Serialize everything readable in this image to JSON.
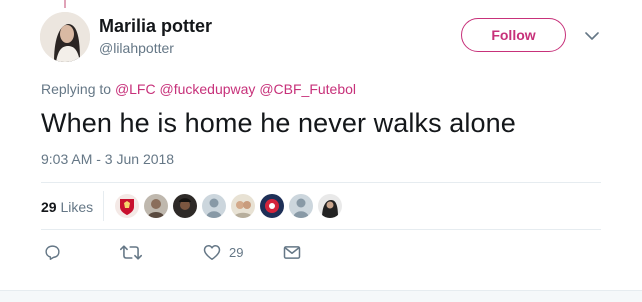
{
  "tweet": {
    "author": {
      "display_name": "Marilia potter",
      "handle": "@lilahpotter",
      "avatar_icon": "profile-photo"
    },
    "follow_label": "Follow",
    "replying_prefix": "Replying to",
    "replying_to": [
      "@LFC",
      "@fuckedupway",
      "@CBF_Futebol"
    ],
    "text": "When he is home he never walks alone",
    "timestamp": "9:03 AM - 3 Jun 2018",
    "likes": {
      "count": "29",
      "label": "Likes",
      "likers": [
        "liverpool-crest-avatar",
        "user-avatar-2",
        "user-avatar-3",
        "default-avatar",
        "user-avatar-5",
        "user-avatar-6",
        "default-avatar",
        "user-avatar-8"
      ]
    },
    "actions": {
      "reply_icon": "reply-icon",
      "retweet_icon": "retweet-icon",
      "like_icon": "heart-icon",
      "like_count": "29",
      "dm_icon": "envelope-icon"
    }
  },
  "colors": {
    "accent": "#c7317a",
    "text": "#14171a",
    "secondary": "#657786",
    "divider": "#e6ecf0"
  }
}
